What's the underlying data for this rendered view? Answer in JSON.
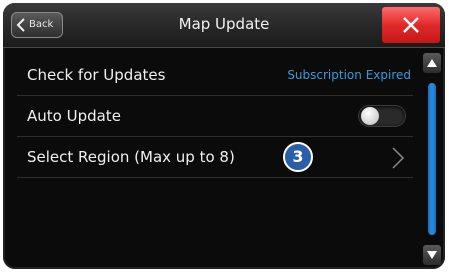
{
  "header": {
    "back_label": "Back",
    "title": "Map Update"
  },
  "rows": [
    {
      "label": "Check for Updates",
      "value": "Subscription Expired"
    },
    {
      "label": "Auto Update",
      "toggle_on": false
    },
    {
      "label": "Select Region (Max up to 8)",
      "badge": "3"
    }
  ],
  "colors": {
    "accent_blue": "#3a9ad9",
    "close_red": "#e02a2a",
    "badge_blue": "#2a5ea8"
  },
  "icons": {
    "back": "chevron-left-icon",
    "close": "close-icon",
    "row_arrow": "chevron-right-icon",
    "scroll_up": "triangle-up-icon",
    "scroll_down": "triangle-down-icon"
  }
}
